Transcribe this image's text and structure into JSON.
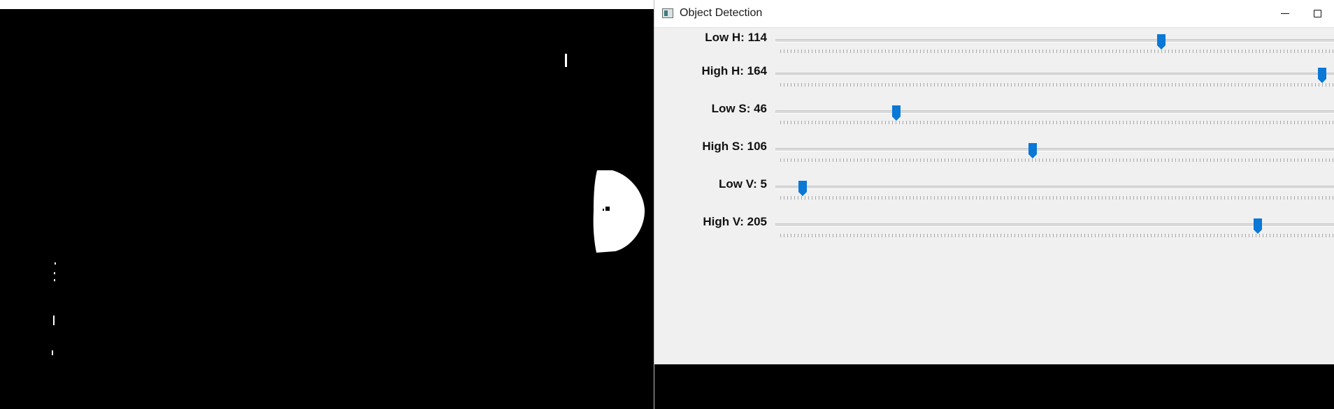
{
  "mask_view": {
    "background": "#000000",
    "foreground": "#ffffff"
  },
  "window": {
    "title": "Object Detection",
    "icon": "opencv-window-icon",
    "controls": [
      "minimize-icon",
      "maximize-icon"
    ]
  },
  "trackbars": [
    {
      "label": "Low H: 114",
      "value": 114,
      "max": 179
    },
    {
      "label": "High H: 164",
      "value": 164,
      "max": 179
    },
    {
      "label": "Low S: 46",
      "value": 46,
      "max": 255
    },
    {
      "label": "High S: 106",
      "value": 106,
      "max": 255
    },
    {
      "label": "Low V: 5",
      "value": 5,
      "max": 255
    },
    {
      "label": "High V: 205",
      "value": 205,
      "max": 255
    }
  ],
  "colors": {
    "thumb": "#0a78d7",
    "panel": "#f0f0f0"
  }
}
